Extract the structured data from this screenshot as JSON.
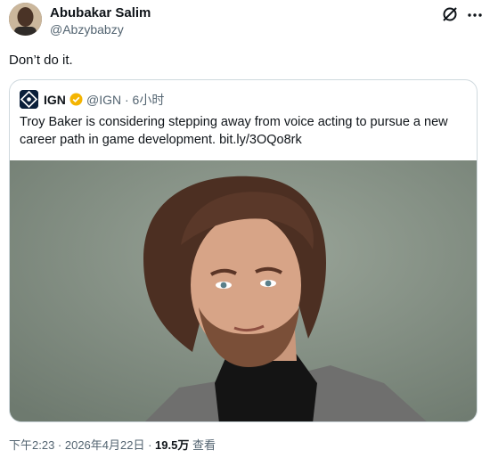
{
  "tweet": {
    "author_name": "Abubakar Salim",
    "author_handle": "@Abzybabzy",
    "text": "Don’t do it.",
    "icons": {
      "grok": "grok-icon",
      "more": "more-options-icon"
    }
  },
  "quote": {
    "name": "IGN",
    "handle_time": "@IGN · 6小时",
    "text": "Troy Baker is considering stepping away from voice acting to pursue a new career path in game development. bit.ly/3OQo8rk",
    "verified_color": "#f4b400"
  },
  "footer": {
    "time_date": "下午2:23 · 2026年4月22日 · ",
    "views": "19.5万",
    "views_label": " 查看"
  }
}
